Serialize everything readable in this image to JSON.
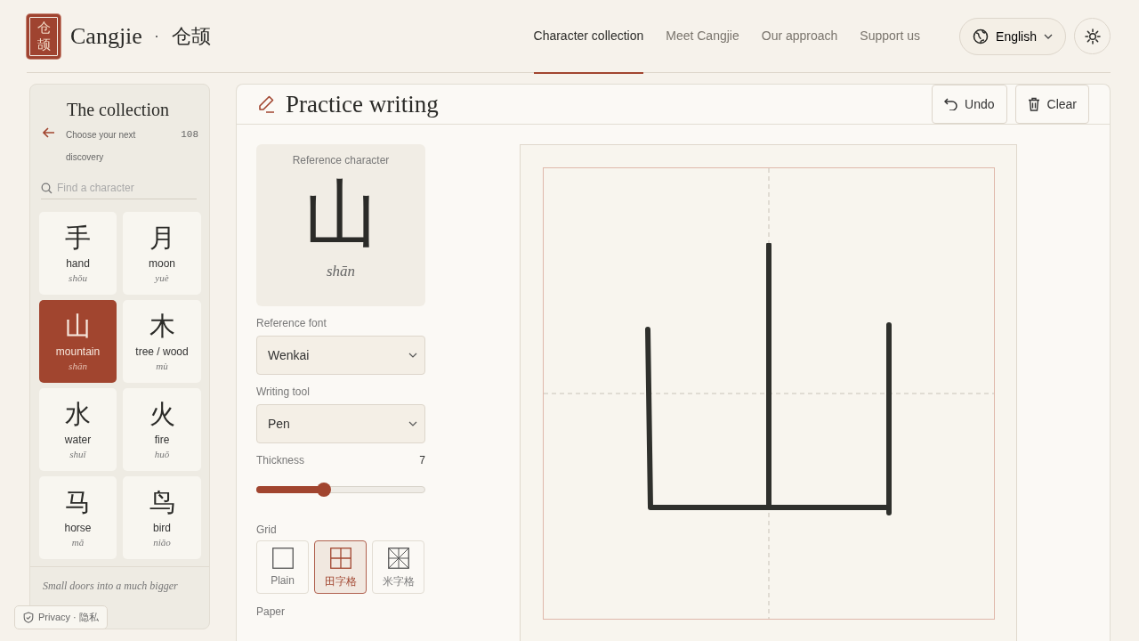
{
  "brand": {
    "seal_top": "仓",
    "seal_bottom": "颉",
    "name": "Cangjie",
    "separator": "·",
    "name_cjk": "仓颉"
  },
  "nav": [
    {
      "label": "Character collection",
      "selected": true
    },
    {
      "label": "Meet Cangjie",
      "selected": false
    },
    {
      "label": "Our approach",
      "selected": false
    },
    {
      "label": "Support us",
      "selected": false
    }
  ],
  "language": {
    "label": "English"
  },
  "sidebar": {
    "title": "The collection",
    "subtitle": "Choose your next discovery",
    "count": "108",
    "search": {
      "placeholder": "Find a character"
    },
    "characters": [
      {
        "glyph": "手",
        "meaning": "hand",
        "pinyin": "shǒu",
        "selected": false
      },
      {
        "glyph": "月",
        "meaning": "moon",
        "pinyin": "yuè",
        "selected": false
      },
      {
        "glyph": "山",
        "meaning": "mountain",
        "pinyin": "shān",
        "selected": true
      },
      {
        "glyph": "木",
        "meaning": "tree / wood",
        "pinyin": "mù",
        "selected": false
      },
      {
        "glyph": "水",
        "meaning": "water",
        "pinyin": "shuǐ",
        "selected": false
      },
      {
        "glyph": "火",
        "meaning": "fire",
        "pinyin": "huǒ",
        "selected": false
      },
      {
        "glyph": "马",
        "meaning": "horse",
        "pinyin": "mǎ",
        "selected": false
      },
      {
        "glyph": "鸟",
        "meaning": "bird",
        "pinyin": "niǎo",
        "selected": false
      }
    ],
    "footer": "Small doors into a much bigger"
  },
  "privacy": {
    "label": "Privacy · 隐私"
  },
  "practice": {
    "title": "Practice writing",
    "buttons": [
      {
        "label": "Undo",
        "kind": "undo"
      },
      {
        "label": "Clear",
        "kind": "clear"
      }
    ],
    "reference": {
      "label": "Reference character",
      "glyph": "山",
      "pinyin": "shān"
    },
    "reference_font": {
      "label": "Reference font",
      "value": "Wenkai"
    },
    "writing_tool": {
      "label": "Writing tool",
      "value": "Pen"
    },
    "thickness": {
      "label": "Thickness",
      "reading": "7",
      "level": 0.4
    },
    "grid": {
      "label": "Grid",
      "options": [
        {
          "label": "Plain",
          "kind": "plain",
          "selected": false
        },
        {
          "label": "田字格",
          "kind": "tian",
          "selected": true
        },
        {
          "label": "米字格",
          "kind": "mi",
          "selected": false
        }
      ]
    },
    "paper": {
      "label": "Paper"
    }
  }
}
